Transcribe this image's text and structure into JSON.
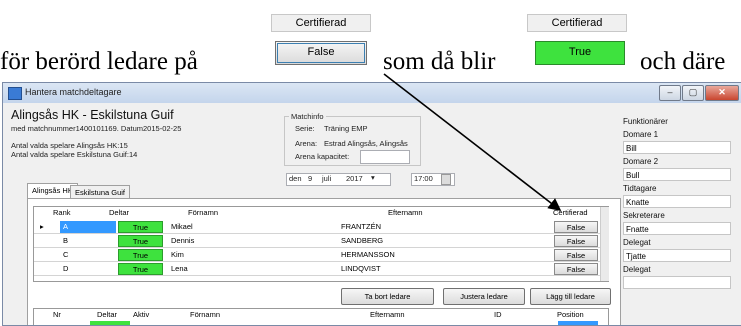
{
  "doc": {
    "line_start": "för berörd ledare på",
    "line_mid": "som då blir",
    "line_end": "och däre",
    "before_label": "Certifierad",
    "before_value": "False",
    "after_label": "Certifierad",
    "after_value": "True"
  },
  "window": {
    "title": "Hantera matchdeltagare",
    "min": "–",
    "max": "▢",
    "close": "✕"
  },
  "header": {
    "teams": "Alingsås HK - Eskilstuna Guif",
    "match_line": "med matchnummer1400101169. Datum2015-02-25",
    "count_home": "Antal valda spelare Alingsås HK:15",
    "count_away": "Antal valda spelare Eskilstuna Guif:14"
  },
  "matchinfo": {
    "title": "Matchinfo",
    "serie_label": "Serie:",
    "serie_value": "Träning EMP",
    "arena_label": "Arena:",
    "arena_value": "Estrad Alingsås, Alingsås",
    "capacity_label": "Arena kapacitet:",
    "capacity_value": "",
    "date_day": "den",
    "date_num": "9",
    "date_month": "juli",
    "date_year": "2017",
    "time": "17:00"
  },
  "tabs": [
    "Alingsås HK",
    "Eskilstuna Guif"
  ],
  "leaders": {
    "headers": [
      "Rank",
      "Deltar",
      "Förnamn",
      "Efternamn",
      "Certifierad"
    ],
    "rows": [
      {
        "rank": "A",
        "deltar": "True",
        "fornamn": "Mikael",
        "efternamn": "FRANTZÉN",
        "cert": "False"
      },
      {
        "rank": "B",
        "deltar": "True",
        "fornamn": "Dennis",
        "efternamn": "SANDBERG",
        "cert": "False"
      },
      {
        "rank": "C",
        "deltar": "True",
        "fornamn": "Kim",
        "efternamn": "HERMANSSON",
        "cert": "False"
      },
      {
        "rank": "D",
        "deltar": "True",
        "fornamn": "Lena",
        "efternamn": "LINDQVIST",
        "cert": "False"
      }
    ]
  },
  "buttons": {
    "remove": "Ta bort ledare",
    "adjust": "Justera ledare",
    "add": "Lägg till ledare"
  },
  "players": {
    "headers": [
      "Nr",
      "Deltar",
      "Aktiv",
      "Förnamn",
      "Efternamn",
      "ID",
      "Position"
    ]
  },
  "officials": {
    "title": "Funktionärer",
    "items": [
      {
        "label": "Domare 1",
        "value": "Bill"
      },
      {
        "label": "Domare 2",
        "value": "Bull"
      },
      {
        "label": "Tidtagare",
        "value": "Knatte"
      },
      {
        "label": "Sekreterare",
        "value": "Fnatte"
      },
      {
        "label": "Delegat",
        "value": "Tjatte"
      },
      {
        "label": "Delegat",
        "value": ""
      }
    ]
  }
}
